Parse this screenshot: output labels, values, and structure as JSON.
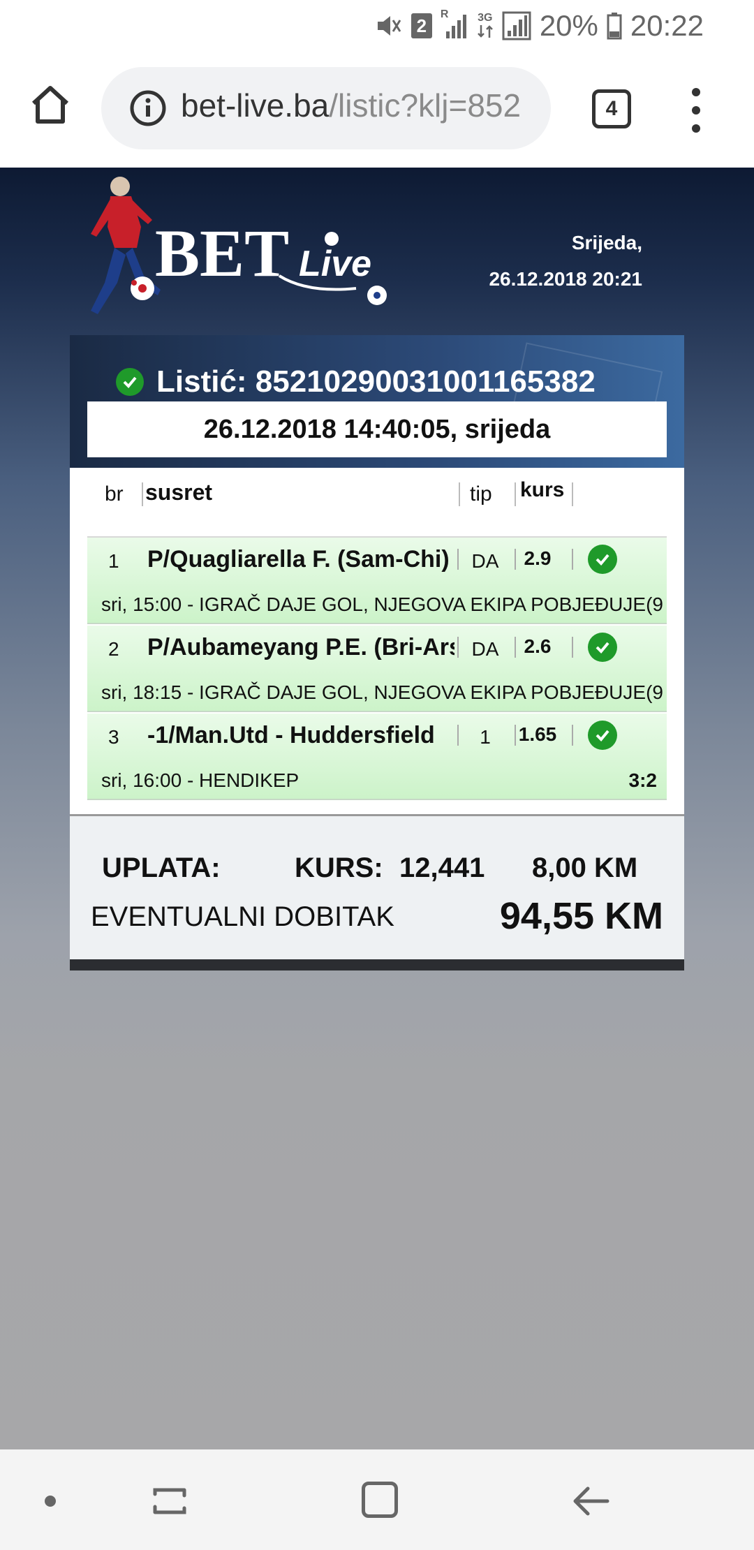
{
  "status_bar": {
    "sim_slot": "2",
    "network_r_label": "R",
    "network_3g_label": "3G",
    "battery": "20%",
    "time": "20:22"
  },
  "browser": {
    "url_domain": "bet-live.ba",
    "url_path": "/listic?klj=852",
    "tab_count": "4"
  },
  "header": {
    "logo_text_main": "BET",
    "logo_text_sub": "Live",
    "day": "Srijeda,",
    "datetime": "26.12.2018 20:21"
  },
  "ticket": {
    "title": "Listić: 85210290031001165382",
    "date": "26.12.2018 14:40:05, srijeda",
    "columns": {
      "br": "br",
      "susret": "susret",
      "tip": "tip",
      "kurs": "kurs"
    },
    "rows": [
      {
        "num": "1",
        "match": "P/Quagliarella F. (Sam-Chi)",
        "tip": "DA",
        "odds": "2.9",
        "detail": "sri, 15:00 - IGRAČ DAJE GOL, NJEGOVA EKIPA POBJEĐUJE(9",
        "result": ""
      },
      {
        "num": "2",
        "match": "P/Aubameyang P.E. (Bri-Ars)",
        "tip": "DA",
        "odds": "2.6",
        "detail": "sri, 18:15 - IGRAČ DAJE GOL, NJEGOVA EKIPA POBJEĐUJE(9",
        "result": ""
      },
      {
        "num": "3",
        "match": "-1/Man.Utd - Huddersfield",
        "tip": "1",
        "odds": "1.65",
        "detail": "sri, 16:00 - HENDIKEP",
        "result": "3:2"
      }
    ],
    "summary": {
      "uplata_label": "UPLATA:",
      "kurs_label": "KURS:",
      "kurs_value": "12,441",
      "stake": "8,00 KM",
      "win_label": "EVENTUALNI DOBITAK",
      "win_value": "94,55 KM"
    }
  },
  "colors": {
    "win_green": "#1f9a2a",
    "row_green": "#ccf3c9",
    "header_dark": "#0d1a33"
  }
}
